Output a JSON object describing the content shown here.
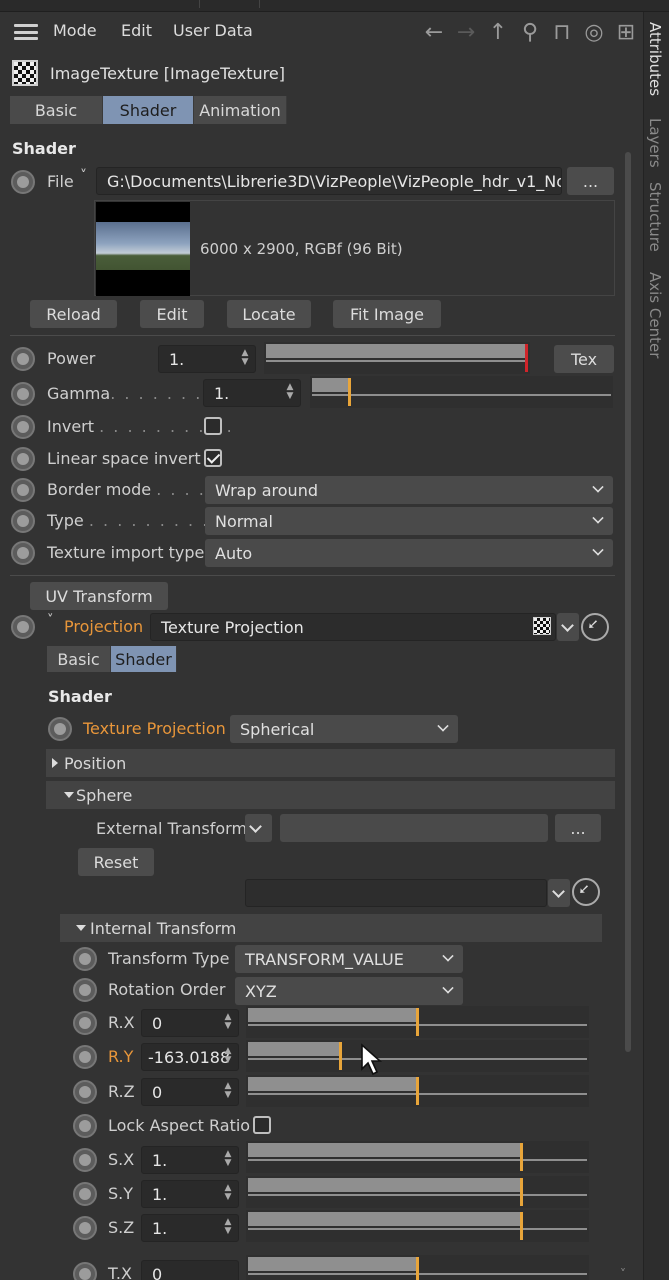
{
  "menu": {
    "mode": "Mode",
    "edit": "Edit",
    "user_data": "User Data"
  },
  "toolbar_icons": [
    "arrow-left-icon",
    "arrow-right-icon",
    "arrow-up-icon",
    "search-icon",
    "lock-icon",
    "target-icon",
    "new-window-icon"
  ],
  "object": {
    "name": "ImageTexture [ImageTexture]"
  },
  "tabs": [
    "Basic",
    "Shader",
    "Animation"
  ],
  "active_tab": "Shader",
  "shader": {
    "heading": "Shader",
    "file_label": "File",
    "file_path": "G:\\Documents\\Librerie3D\\VizPeople\\VizPeople_hdr_v1_Nor",
    "browse": "...",
    "image_info": "6000 x 2900, RGBf (96 Bit)",
    "buttons": {
      "reload": "Reload",
      "edit": "Edit",
      "locate": "Locate",
      "fit_image": "Fit Image"
    },
    "power_label": "Power",
    "power_value": "1.",
    "tex_button": "Tex",
    "gamma_label": "Gamma",
    "gamma_dots": ". . . . . . . .",
    "gamma_value": "1.",
    "invert_label": "Invert",
    "invert_dots": ". . . . . . . . . .",
    "lsi_label": "Linear space invert",
    "border_label": "Border mode",
    "border_dots": ". . . .",
    "border_value": "Wrap around",
    "type_label": "Type",
    "type_dots": ". . . . . . . . . . .",
    "type_value": "Normal",
    "tit_label": "Texture import type",
    "tit_value": "Auto",
    "uv_transform": "UV Transform",
    "projection_label": "Projection",
    "projection_value": "Texture Projection"
  },
  "sub_tabs": [
    "Basic",
    "Shader"
  ],
  "proj": {
    "heading": "Shader",
    "tp_label": "Texture Projection",
    "tp_value": "Spherical",
    "position": "Position",
    "sphere": "Sphere",
    "ext_label": "External Transform",
    "ext_browse": "...",
    "reset": "Reset",
    "internal": "Internal Transform",
    "tt_label": "Transform Type",
    "tt_value": "TRANSFORM_VALUE",
    "ro_label": "Rotation Order",
    "ro_value": "XYZ",
    "rx_label": "R.X",
    "rx_value": "0",
    "ry_label": "R.Y",
    "ry_value": "-163.0188",
    "rz_label": "R.Z",
    "rz_value": "0",
    "lock_label": "Lock Aspect Ratio",
    "sx_label": "S.X",
    "sx_value": "1.",
    "sy_label": "S.Y",
    "sy_value": "1.",
    "sz_label": "S.Z",
    "sz_value": "1.",
    "tx_label": "T.X",
    "tx_value": "0"
  },
  "sliders": {
    "power": 1.0,
    "gamma": 0.12,
    "rx": 0.5,
    "ry": 0.27,
    "rz": 0.5,
    "sx": 0.81,
    "sy": 0.81,
    "sz": 0.81,
    "tx": 0.5
  },
  "checks": {
    "invert": false,
    "linear_space_invert": true,
    "lock_aspect_ratio": false
  },
  "side_tabs": [
    "Attributes",
    "Layers",
    "Structure",
    "Axis Center"
  ],
  "colors": {
    "accent_tab": "#7f94b3",
    "slider_handle": "#e8a53a",
    "power_handle": "#d0242a",
    "label_highlight": "#e8963a"
  }
}
